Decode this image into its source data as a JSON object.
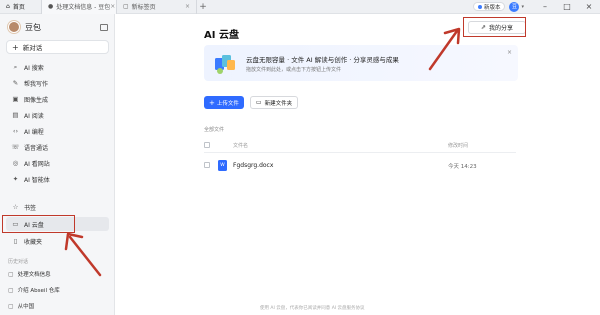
{
  "tabs": [
    {
      "label": "首页",
      "icon": "home-icon"
    },
    {
      "label": "处理文档信息 - 豆包",
      "icon": "doubao-icon"
    },
    {
      "label": "新标签页",
      "icon": "page-icon"
    }
  ],
  "titlebar": {
    "new_version": "新版本",
    "account_initial": "豆"
  },
  "sidebar": {
    "title": "豆包",
    "new_chat": "新对话",
    "items": [
      {
        "label": "AI 搜索",
        "icon": "search-icon"
      },
      {
        "label": "帮我写作",
        "icon": "pen-icon"
      },
      {
        "label": "图像生成",
        "icon": "image-icon"
      },
      {
        "label": "AI 阅读",
        "icon": "book-icon"
      },
      {
        "label": "AI 编程",
        "icon": "code-icon"
      },
      {
        "label": "语音通话",
        "icon": "phone-icon"
      },
      {
        "label": "AI 看网站",
        "icon": "globe-icon"
      },
      {
        "label": "AI 智能体",
        "icon": "agent-icon"
      }
    ],
    "items2": [
      {
        "label": "书签",
        "icon": "star-icon"
      },
      {
        "label": "AI 云盘",
        "icon": "folder-icon"
      },
      {
        "label": "收藏夹",
        "icon": "bookmark-icon"
      }
    ],
    "history_label": "历史对话",
    "history": [
      {
        "label": "处理文档信息"
      },
      {
        "label": "介绍 Abseil 仓库"
      },
      {
        "label": "从中国"
      }
    ]
  },
  "main": {
    "title": "AI 云盘",
    "share_button": "我的分享",
    "banner": {
      "title": "云盘无限容量 · 文件 AI 解读与创作 · 分享灵感与成果",
      "subtitle": "拖放文件到此处，或点击下方按钮上传文件",
      "close": "×"
    },
    "upload_button": "上传文件",
    "new_folder_button": "新建文件夹",
    "all_files": "全部文件",
    "columns": {
      "name": "文件名",
      "modified": "修改时间"
    },
    "files": [
      {
        "name": "Fgdsgrg.docx",
        "type": "W",
        "modified": "今天 14:23"
      }
    ],
    "footer": "使用 AI 云盘，代表你已阅读并同意 AI 云盘服务协议"
  },
  "colors": {
    "accent": "#2f6bff",
    "annotation": "#c0392b"
  }
}
